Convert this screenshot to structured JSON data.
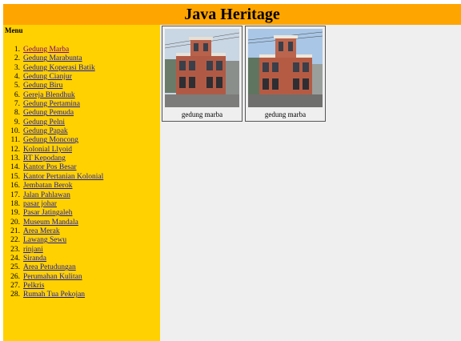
{
  "header": {
    "title": "Java Heritage"
  },
  "sidebar": {
    "menu_title": "Menu",
    "items": [
      {
        "num": "1.",
        "label": "Gedung Marba"
      },
      {
        "num": "2.",
        "label": "Gedung Marabunta"
      },
      {
        "num": "3.",
        "label": "Gedung Koperasi Batik"
      },
      {
        "num": "4.",
        "label": "Gedung Cianjur"
      },
      {
        "num": "5.",
        "label": "Gedung Biru"
      },
      {
        "num": "6.",
        "label": "Gereja Blendhuk"
      },
      {
        "num": "7.",
        "label": "Gedung Pertamina"
      },
      {
        "num": "8.",
        "label": "Gedung Pemuda"
      },
      {
        "num": "9.",
        "label": "Gedung Pelni"
      },
      {
        "num": "10.",
        "label": "Gedung Papak"
      },
      {
        "num": "11.",
        "label": "Gedung Moncong"
      },
      {
        "num": "12.",
        "label": "Kolonial Llyoid"
      },
      {
        "num": "13.",
        "label": "RT Kepodang"
      },
      {
        "num": "14.",
        "label": "Kantor Pos Besar"
      },
      {
        "num": "15.",
        "label": "Kantor Pertanian Kolonial"
      },
      {
        "num": "16.",
        "label": "Jembatan Berok"
      },
      {
        "num": "17.",
        "label": "Jalan Pahlawan"
      },
      {
        "num": "18.",
        "label": "pasar johar"
      },
      {
        "num": "19.",
        "label": "Pasar Jatingaleh"
      },
      {
        "num": "20.",
        "label": "Museum Mandala"
      },
      {
        "num": "21.",
        "label": "Area Merak"
      },
      {
        "num": "22.",
        "label": "Lawang Sewu"
      },
      {
        "num": "23.",
        "label": "rinjani"
      },
      {
        "num": "24.",
        "label": "Siranda"
      },
      {
        "num": "25.",
        "label": "Area Petudungan"
      },
      {
        "num": "26.",
        "label": "Perumahan Kulitan"
      },
      {
        "num": "27.",
        "label": "Pelkris"
      },
      {
        "num": "28.",
        "label": "Rumah Tua Pekojan"
      }
    ]
  },
  "gallery": [
    {
      "caption": "gedung marba"
    },
    {
      "caption": "gedung marba"
    }
  ],
  "colors": {
    "header_bg": "#ffa500",
    "sidebar_bg": "#ffd100",
    "link": "#1a1aa6",
    "visited_link": "#800080",
    "content_bg": "#efefef"
  }
}
